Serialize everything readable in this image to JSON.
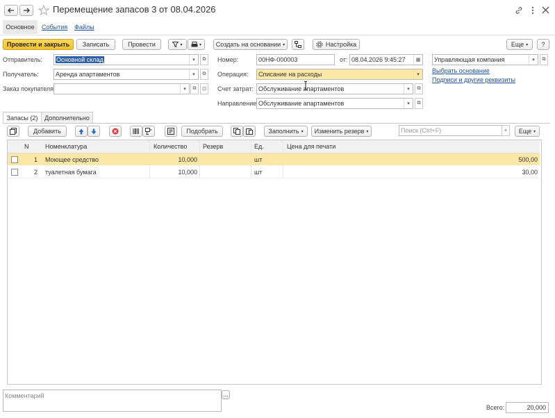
{
  "title": "Перемещение запасов 3 от 08.04.2026",
  "nav": {
    "back_icon": "arrow-left-icon",
    "forward_icon": "arrow-right-icon",
    "star_icon": "star-icon"
  },
  "window_icons": [
    "link-icon",
    "more-icon",
    "close-icon"
  ],
  "tabs_top": [
    "Основное",
    "События",
    "Файлы"
  ],
  "toolbar": {
    "post_close": "Провести и закрыть",
    "save": "Записать",
    "post": "Провести",
    "create_based": "Создать на основании",
    "settings": "Настройка",
    "more": "Еще",
    "help": "?"
  },
  "form": {
    "sender_label": "Отправитель:",
    "sender_value": "Основной склад",
    "receiver_label": "Получатель:",
    "receiver_value": "Аренда апартаментов",
    "order_label": "Заказ покупателя:",
    "order_value": "",
    "number_label": "Номер:",
    "number_value": "00НФ-000003",
    "date_label": "от:",
    "date_value": "08.04.2026  9:45:27",
    "operation_label": "Операция:",
    "operation_value": "Списание на расходы",
    "cost_label": "Счет затрат:",
    "cost_value": "Обслуживание апартаментов",
    "direction_label": "Направление:",
    "direction_value": "Обслуживание апартаментов",
    "company_value": "Управляющая компания",
    "choose_basis": "Выбрать основание",
    "signatures": "Подписи и другие реквизиты"
  },
  "inner_tabs": [
    "Запасы (2)",
    "Дополнительно"
  ],
  "table_toolbar": {
    "add": "Добавить",
    "pick": "Подобрать",
    "fill": "Заполнить",
    "change_reserve": "Изменить резерв",
    "search_placeholder": "Поиск (Ctrl+F)",
    "more": "Еще"
  },
  "table": {
    "columns": [
      "N",
      "Номенклатура",
      "Количество",
      "Резерв",
      "Ед.",
      "Цена для печати"
    ],
    "rows": [
      {
        "n": "1",
        "name": "Моющее средство",
        "qty": "10,000",
        "reserve": "",
        "unit": "шт",
        "price": "500,00"
      },
      {
        "n": "2",
        "name": "туалетная бумага",
        "qty": "10,000",
        "reserve": "",
        "unit": "шт",
        "price": "30,00"
      }
    ]
  },
  "footer": {
    "comment_placeholder": "Комментарий",
    "total_label": "Всего:",
    "total_value": "20,000"
  },
  "colors": {
    "primary": "#f5c22a",
    "selected_row": "#fbe8a7",
    "link": "#1f4f9f"
  }
}
